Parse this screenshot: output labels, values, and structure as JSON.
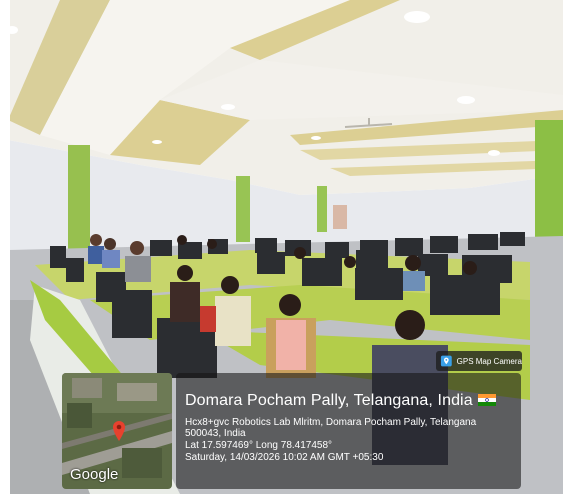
{
  "photo": {
    "subject": "computer-lab-with-seated-people"
  },
  "map_thumbnail": {
    "brand": "Google",
    "marker": "location-pin-icon"
  },
  "badge": {
    "icon": "gps-map-camera-icon",
    "label": "GPS Map Camera"
  },
  "info": {
    "title": "Domara Pocham Pally, Telangana, India",
    "flag": "india-flag-icon",
    "address_line1": "Hcx8+gvc Robotics Lab Mlritm, Domara Pocham Pally, Telangana",
    "address_line2": "500043, India",
    "coordinates": "Lat 17.597469° Long 78.417458°",
    "timestamp": "Saturday, 14/03/2026 10:02 AM GMT +05:30"
  },
  "colors": {
    "wall": "#eaecef",
    "accent_green": "#8fc546",
    "overlay": "#141414"
  }
}
